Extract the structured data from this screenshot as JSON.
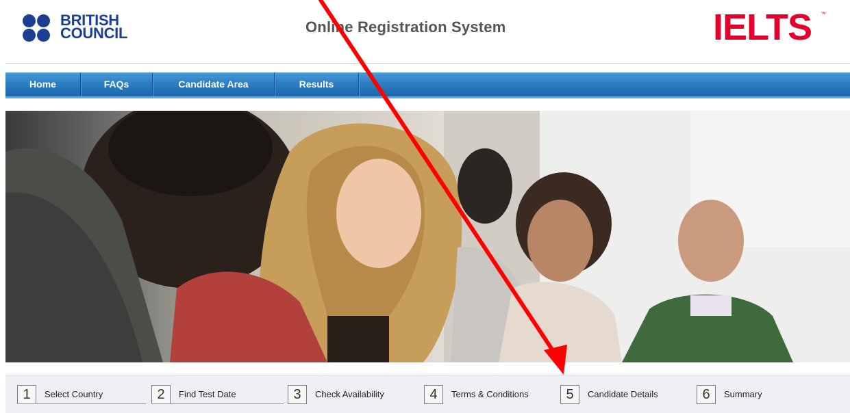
{
  "header": {
    "brand_left_line1": "BRITISH",
    "brand_left_line2": "COUNCIL",
    "title": "Online Registration System",
    "brand_right": "IELTS",
    "brand_right_tm": "™"
  },
  "nav": {
    "items": [
      {
        "label": "Home"
      },
      {
        "label": "FAQs"
      },
      {
        "label": "Candidate Area"
      },
      {
        "label": "Results"
      }
    ]
  },
  "steps": [
    {
      "num": "1",
      "label": "Select Country"
    },
    {
      "num": "2",
      "label": "Find Test Date"
    },
    {
      "num": "3",
      "label": "Check Availability"
    },
    {
      "num": "4",
      "label": "Terms & Conditions"
    },
    {
      "num": "5",
      "label": "Candidate Details"
    },
    {
      "num": "6",
      "label": "Summary"
    }
  ],
  "colors": {
    "british_council_blue": "#1c3f94",
    "ielts_red": "#e4002b",
    "nav_blue": "#2d7fc3",
    "annotation_arrow": "#ff0000"
  },
  "icons": {
    "hero": "students-photo",
    "annotation": "red-arrow"
  }
}
